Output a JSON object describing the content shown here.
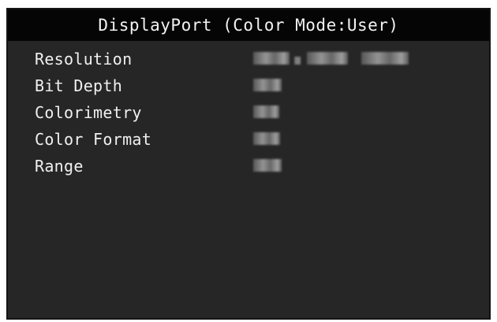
{
  "title": "DisplayPort (Color Mode:User)",
  "rows": [
    {
      "label": "Resolution",
      "value": ""
    },
    {
      "label": "Bit Depth",
      "value": ""
    },
    {
      "label": "Colorimetry",
      "value": ""
    },
    {
      "label": "Color Format",
      "value": ""
    },
    {
      "label": "Range",
      "value": ""
    }
  ],
  "colors": {
    "panel_bg": "#262626",
    "title_bg": "#050505",
    "text": "#f0f0f0"
  }
}
